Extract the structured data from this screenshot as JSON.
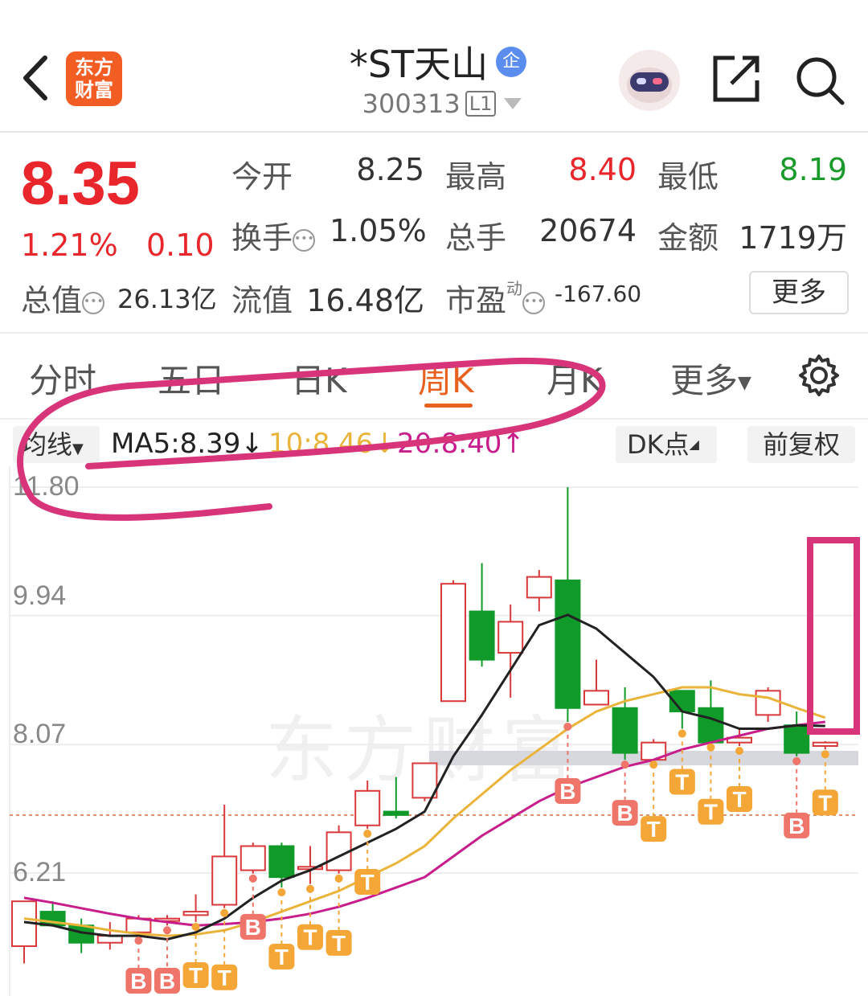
{
  "header": {
    "logo_text_line1": "东方",
    "logo_text_line2": "财富",
    "title": "*ST天山",
    "title_badge": "企",
    "code": "300313",
    "level_badge": "L1"
  },
  "quote": {
    "price": "8.35",
    "change_pct": "1.21%",
    "change_abs": "0.10",
    "open_label": "今开",
    "open_value": "8.25",
    "high_label": "最高",
    "high_value": "8.40",
    "low_label": "最低",
    "low_value": "8.19",
    "turnover_label": "换手",
    "turnover_value": "1.05%",
    "volume_label": "总手",
    "volume_value": "20674",
    "amount_label": "金额",
    "amount_value": "1719万",
    "mktcap_label": "总值",
    "mktcap_value": "26.13亿",
    "float_label": "流值",
    "float_value": "16.48亿",
    "pe_label": "市盈",
    "pe_sup": "动",
    "pe_value": "-167.60",
    "more_button": "更多"
  },
  "tabs": {
    "items": [
      "分时",
      "五日",
      "日K",
      "周K",
      "月K",
      "更多"
    ],
    "active": "周K"
  },
  "indicators": {
    "select_label": "均线",
    "ma5": "MA5:8.39↓",
    "ma10": "10:8.46↓",
    "ma20": "20:8.40↑",
    "dk_button": "DK点",
    "adjust_button": "前复权"
  },
  "chart_data": {
    "type": "candlestick",
    "y_ticks": [
      "11.80",
      "9.94",
      "8.07",
      "6.21"
    ],
    "watermark": "东方财富",
    "colors": {
      "up": "#d9393a",
      "down": "#109a2a",
      "ma5": "#222222",
      "ma10": "#eab33a",
      "ma20": "#c81e8c",
      "signal_b": "#ef7469",
      "signal_t": "#f4a637",
      "annotation": "#d8347a"
    },
    "candles": [
      {
        "open": 5.15,
        "close": 5.8,
        "high": 5.8,
        "low": 4.9
      },
      {
        "open": 5.65,
        "close": 5.45,
        "high": 5.8,
        "low": 5.45
      },
      {
        "open": 5.45,
        "close": 5.2,
        "high": 5.55,
        "low": 5.05
      },
      {
        "open": 5.2,
        "close": 5.3,
        "high": 5.5,
        "low": 5.1
      },
      {
        "open": 5.35,
        "close": 5.55,
        "high": 5.6,
        "low": 5.3
      },
      {
        "open": 5.55,
        "close": 5.55,
        "high": 5.6,
        "low": 5.45
      },
      {
        "open": 5.6,
        "close": 5.65,
        "high": 5.9,
        "low": 5.5
      },
      {
        "open": 5.75,
        "close": 6.45,
        "high": 7.2,
        "low": 5.7
      },
      {
        "open": 6.25,
        "close": 6.6,
        "high": 6.65,
        "low": 6.2
      },
      {
        "open": 6.6,
        "close": 6.15,
        "high": 6.65,
        "low": 6.0
      },
      {
        "open": 6.3,
        "close": 6.3,
        "high": 6.6,
        "low": 6.05
      },
      {
        "open": 6.25,
        "close": 6.8,
        "high": 6.9,
        "low": 6.2
      },
      {
        "open": 6.9,
        "close": 7.4,
        "high": 7.55,
        "low": 6.85
      },
      {
        "open": 7.1,
        "close": 7.05,
        "high": 7.6,
        "low": 7.0
      },
      {
        "open": 7.3,
        "close": 7.8,
        "high": 7.8,
        "low": 7.25
      },
      {
        "open": 8.7,
        "close": 10.4,
        "high": 10.45,
        "low": 8.7
      },
      {
        "open": 10.0,
        "close": 9.3,
        "high": 10.7,
        "low": 9.2
      },
      {
        "open": 9.4,
        "close": 9.85,
        "high": 10.1,
        "low": 8.75
      },
      {
        "open": 10.2,
        "close": 10.5,
        "high": 10.6,
        "low": 10.0
      },
      {
        "open": 10.45,
        "close": 8.6,
        "high": 11.8,
        "low": 8.4
      },
      {
        "open": 8.65,
        "close": 8.85,
        "high": 9.3,
        "low": 8.65
      },
      {
        "open": 8.6,
        "close": 7.95,
        "high": 8.9,
        "low": 7.85
      },
      {
        "open": 7.85,
        "close": 8.1,
        "high": 8.15,
        "low": 7.85
      },
      {
        "open": 8.85,
        "close": 8.55,
        "high": 8.85,
        "low": 8.3
      },
      {
        "open": 8.6,
        "close": 8.1,
        "high": 9.0,
        "low": 8.1
      },
      {
        "open": 8.1,
        "close": 8.17,
        "high": 8.3,
        "low": 8.05
      },
      {
        "open": 8.5,
        "close": 8.85,
        "high": 8.9,
        "low": 8.4
      },
      {
        "open": 8.35,
        "close": 7.95,
        "high": 8.55,
        "low": 7.9
      },
      {
        "open": 8.05,
        "close": 8.1,
        "high": 8.12,
        "low": 8.0
      }
    ],
    "ma5": [
      5.5,
      5.45,
      5.35,
      5.3,
      5.3,
      5.25,
      5.35,
      5.55,
      5.85,
      6.1,
      6.25,
      6.45,
      6.65,
      6.85,
      7.1,
      7.9,
      8.5,
      9.15,
      9.8,
      9.95,
      9.75,
      9.4,
      9.05,
      8.55,
      8.45,
      8.3,
      8.3,
      8.35,
      8.34
    ],
    "ma10": [
      5.55,
      5.5,
      5.45,
      5.38,
      5.33,
      5.3,
      5.32,
      5.38,
      5.5,
      5.65,
      5.8,
      5.95,
      6.15,
      6.35,
      6.6,
      7.0,
      7.35,
      7.7,
      8.0,
      8.3,
      8.55,
      8.7,
      8.8,
      8.9,
      8.9,
      8.8,
      8.75,
      8.6,
      8.46
    ],
    "ma20": [
      5.85,
      5.78,
      5.7,
      5.62,
      5.55,
      5.5,
      5.45,
      5.47,
      5.5,
      5.55,
      5.62,
      5.72,
      5.85,
      6.0,
      6.15,
      6.45,
      6.75,
      7.0,
      7.25,
      7.45,
      7.6,
      7.75,
      7.85,
      8.0,
      8.1,
      8.2,
      8.3,
      8.35,
      8.4
    ],
    "signals": [
      {
        "i": 4,
        "type": "B"
      },
      {
        "i": 5,
        "type": "B"
      },
      {
        "i": 6,
        "type": "T"
      },
      {
        "i": 7,
        "type": "T"
      },
      {
        "i": 8,
        "type": "B"
      },
      {
        "i": 9,
        "type": "T"
      },
      {
        "i": 10,
        "type": "T"
      },
      {
        "i": 11,
        "type": "T"
      },
      {
        "i": 12,
        "type": "T"
      },
      {
        "i": 19,
        "type": "B"
      },
      {
        "i": 21,
        "type": "B"
      },
      {
        "i": 22,
        "type": "T"
      },
      {
        "i": 23,
        "type": "T"
      },
      {
        "i": 24,
        "type": "T"
      },
      {
        "i": 25,
        "type": "T"
      },
      {
        "i": 27,
        "type": "B"
      },
      {
        "i": 28,
        "type": "T"
      }
    ]
  }
}
